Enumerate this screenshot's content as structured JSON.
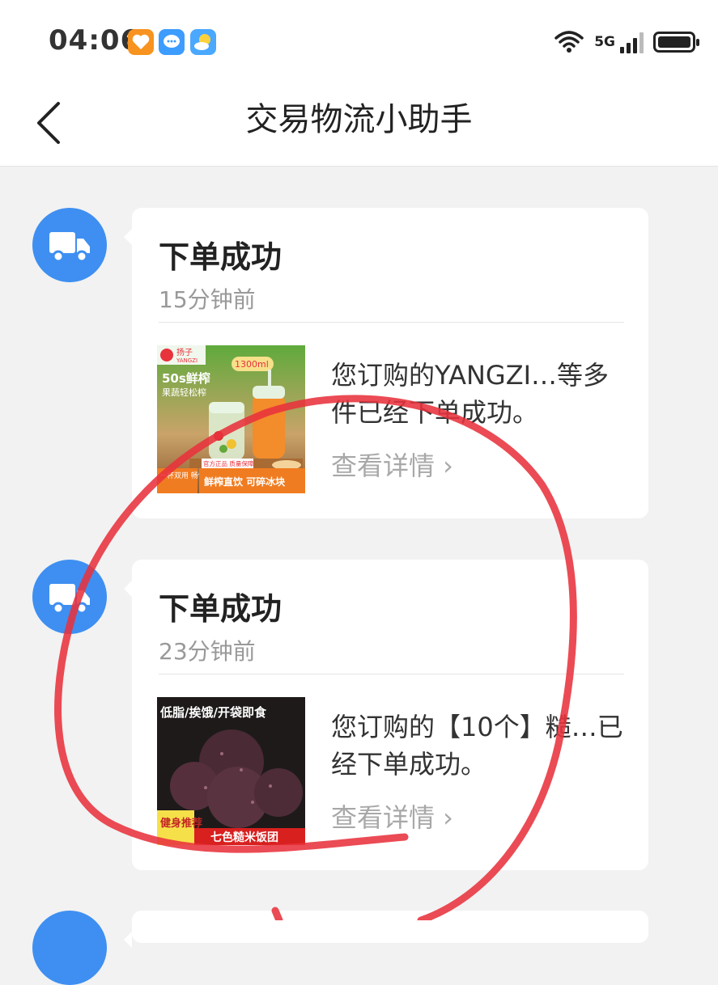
{
  "status_bar": {
    "time": "04:06",
    "network": "5G",
    "icons": [
      "health-app-icon",
      "message-app-icon",
      "weather-app-icon",
      "wifi-icon",
      "signal-icon",
      "battery-icon"
    ]
  },
  "header": {
    "title": "交易物流小助手",
    "back_icon": "chevron-left-icon"
  },
  "messages": [
    {
      "title": "下单成功",
      "time": "15分钟前",
      "text": "您订购的YANGZI…等多件已经下单成功。",
      "link": "查看详情 ›",
      "image": {
        "brand": "扬子",
        "brand_en": "YANGZI",
        "capacity": "1300ml",
        "headline": "50s鲜榨",
        "subline": "果蔬轻松榨",
        "badge": "官方正品 质量保障",
        "footer_left": "一杯双用 畅饮随行",
        "footer_right": "鲜榨直饮 可碎冰块"
      }
    },
    {
      "title": "下单成功",
      "time": "23分钟前",
      "text": "您订购的【10个】糙…已经下单成功。",
      "link": "查看详情 ›",
      "image": {
        "headline": "低脂/挨饿/开袋即食",
        "badge": "健身推荐",
        "footer": "七色糙米饭团"
      }
    }
  ],
  "colors": {
    "accent": "#3e8ff1",
    "annotation": "#e8323c",
    "background": "#f2f2f2"
  }
}
